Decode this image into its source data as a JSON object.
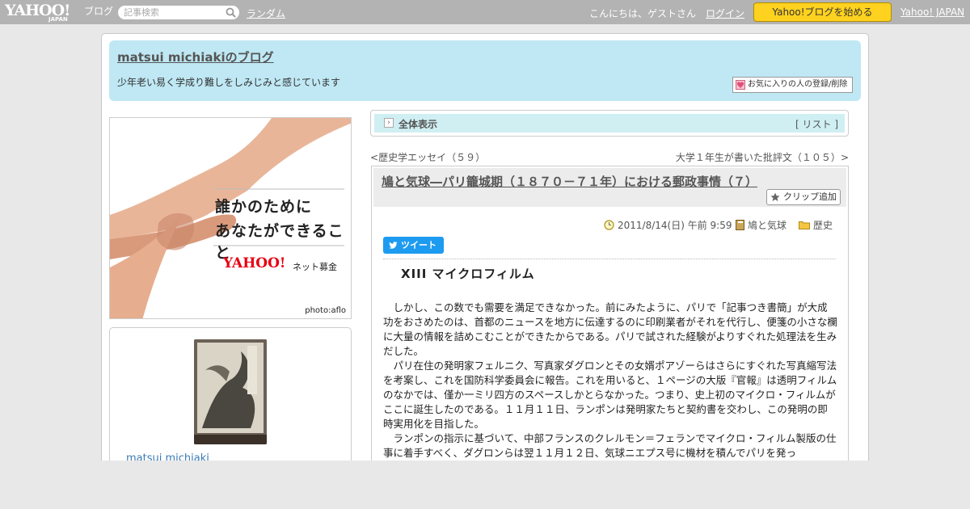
{
  "topbar": {
    "logo_text": "YAHOO!",
    "logo_sub": "JAPAN",
    "logo_blog": "ブログ",
    "search_placeholder": "記事検索",
    "random_link": "ランダム",
    "greeting": "こんにちは、ゲストさん",
    "login_link": "ログイン",
    "start_button": "Yahoo!ブログを始める",
    "yahoo_japan_link": "Yahoo! JAPAN"
  },
  "header": {
    "blog_title": "matsui michiakiのブログ",
    "description": "少年老い易く学成り難しをしみじみと感じています",
    "favorite_button": "お気に入りの人の登録/削除"
  },
  "ad": {
    "line1": "誰かのために",
    "line2": "あなたができること",
    "logo": "YAHOO!",
    "logo_sub": "ネット募金",
    "credit": "photo:aflo"
  },
  "profile": {
    "name": "matsui michiaki"
  },
  "nav": {
    "label": "全体表示",
    "list_link": "リスト",
    "list_open": "[",
    "list_close": "]",
    "prev_link": "歴史学エッセイ（５９）",
    "next_link": "大学１年生が書いた批評文（１０５）"
  },
  "article": {
    "title": "鳩と気球―パリ籠城期（１８７０－７１年）における郵政事情（７）",
    "clip_button": "クリップ追加",
    "date": "2011/8/14(日) 午前 9:59",
    "category1": "鳩と気球",
    "category2": "歴史",
    "tweet_button": "ツイート",
    "section_heading": "XIII マイクロフィルム",
    "paragraphs": [
      "しかし、この数でも需要を満足できなかった。前にみたように、パリで「記事つき書簡」が大成功をおさめたのは、首都のニュースを地方に伝達するのに印刷業者がそれを代行し、便箋の小さな欄に大量の情報を詰めこむことができたからである。パリで試された経験がよりすぐれた処理法を生みだした。",
      "パリ在住の発明家フェルニク、写真家ダグロンとその女婿ポアゾーらはさらにすぐれた写真縮写法を考案し、これを国防科学委員会に報告。これを用いると、１ページの大版『官報』は透明フィルムのなかでは、僅か一ミリ四方のスペースしかとらなかった。つまり、史上初のマイクロ・フィルムがここに誕生したのである。１１月１１日、ランポンは発明家たちと契約書を交わし、この発明の即時実用化を目指した。",
      "ランポンの指示に基づいて、中部フランスのクレルモン＝フェランでマイクロ・フィルム製版の仕事に着手すべく、ダグロンらは翌１１月１２日、気球ニエプス号に機材を積んでパリを発っ"
    ]
  },
  "colors": {
    "topbar": "#b3b3b3",
    "header_bg": "#bfe8f4",
    "start_button": "#ffd21f",
    "tweet_blue": "#1d9bf0",
    "link_blue": "#3a7bb5"
  }
}
